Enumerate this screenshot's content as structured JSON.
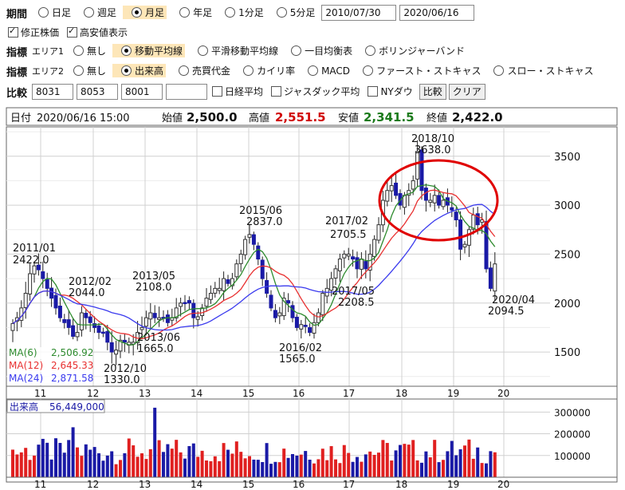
{
  "controls": {
    "period": {
      "label": "期間",
      "options": [
        "日足",
        "週足",
        "月足",
        "年足",
        "1分足",
        "5分足"
      ],
      "selected": "月足",
      "from": "2010/07/30",
      "to": "2020/06/16"
    },
    "checks": [
      {
        "label": "修正株価",
        "checked": true
      },
      {
        "label": "高安値表示",
        "checked": true
      }
    ],
    "indicator1": {
      "label": "指標",
      "sub": "エリア1",
      "options": [
        "無し",
        "移動平均線",
        "平滑移動平均線",
        "一目均衡表",
        "ボリンジャーバンド"
      ],
      "selected": "移動平均線"
    },
    "indicator2": {
      "label": "指標",
      "sub": "エリア2",
      "options": [
        "無し",
        "出来高",
        "売買代金",
        "カイリ率",
        "MACD",
        "ファースト・ストキャス",
        "スロー・ストキャス"
      ],
      "selected": "出来高"
    },
    "compare": {
      "label": "比較",
      "codes": [
        "8031",
        "8053",
        "8001",
        ""
      ],
      "checks": [
        "日経平均",
        "ジャスダック平均",
        "NYダウ"
      ],
      "compare_button": "比較",
      "clear_button": "クリア"
    }
  },
  "header": {
    "date_label": "日付",
    "date": "2020/06/16 15:00",
    "open_label": "始値",
    "open": "2,500.0",
    "high_label": "高値",
    "high": "2,551.5",
    "low_label": "安値",
    "low": "2,341.5",
    "close_label": "終値",
    "close": "2,422.0"
  },
  "colors": {
    "up": "#cc0000",
    "down": "#1a1aa6",
    "ma6": "#2e8b2e",
    "ma12": "#e83030",
    "ma24": "#3a3aee",
    "grid": "#d0d0d0",
    "circle": "#e00000",
    "vol_red": "#e02020",
    "vol_blue": "#1a1aa6"
  },
  "chart_data": [
    {
      "type": "candlestick",
      "title": "",
      "x_labels": [
        "11",
        "12",
        "13",
        "14",
        "15",
        "16",
        "17",
        "18",
        "19",
        "20"
      ],
      "y_ticks": [
        1500,
        2000,
        2500,
        3000,
        3500
      ],
      "ylim": [
        1150,
        3800
      ],
      "legend": [
        {
          "name": "MA(6)",
          "value": "2,506.92"
        },
        {
          "name": "MA(12)",
          "value": "2,645.33"
        },
        {
          "name": "MA(24)",
          "value": "2,871.58"
        }
      ],
      "annotations": [
        {
          "date": "2011/01",
          "value": "2422.0"
        },
        {
          "date": "2012/02",
          "value": "2044.0"
        },
        {
          "date": "2013/05",
          "value": "2108.0"
        },
        {
          "date": "2015/06",
          "value": "2837.0"
        },
        {
          "date": "2017/02",
          "value": "2705.5"
        },
        {
          "date": "2018/10",
          "value": "3638.0"
        },
        {
          "date": "2013/06",
          "value": "1665.0"
        },
        {
          "date": "2012/10",
          "value": "1330.0"
        },
        {
          "date": "2016/02",
          "value": "1565.0"
        },
        {
          "date": "2017/05",
          "value": "2208.5"
        },
        {
          "date": "2020/04",
          "value": "2094.5"
        }
      ],
      "closes": [
        1790,
        1850,
        1950,
        2100,
        2300,
        2380,
        2340,
        2250,
        2150,
        2050,
        1950,
        1850,
        1800,
        1750,
        1660,
        1700,
        1900,
        1850,
        1800,
        1750,
        1700,
        1700,
        1600,
        1500,
        1520,
        1620,
        1600,
        1600,
        1600,
        1700,
        1750,
        1850,
        1900,
        1850,
        1850,
        1850,
        1800,
        1850,
        1950,
        2000,
        2000,
        2000,
        1850,
        1860,
        1950,
        2050,
        2100,
        2150,
        2150,
        2250,
        2200,
        2250,
        2400,
        2500,
        2650,
        2700,
        2600,
        2450,
        2250,
        2100,
        1950,
        1850,
        1900,
        2050,
        2000,
        1850,
        1750,
        1780,
        1760,
        1700,
        1800,
        1900,
        2100,
        2150,
        2250,
        2350,
        2450,
        2500,
        2500,
        2450,
        2350,
        2450,
        2350,
        2500,
        2650,
        2800,
        3050,
        3150,
        3200,
        3100,
        3000,
        3100,
        3150,
        3250,
        3550,
        3150,
        3050,
        3050,
        3100,
        3000,
        3050,
        3000,
        2950,
        2850,
        2550,
        2600,
        2750,
        2900,
        2800,
        2850,
        2350,
        2150,
        2400
      ],
      "volumes_note": "approximate",
      "volume": {
        "title": "出来高",
        "value": "56,449,000",
        "y_ticks": [
          100000,
          200000,
          300000
        ]
      }
    }
  ]
}
